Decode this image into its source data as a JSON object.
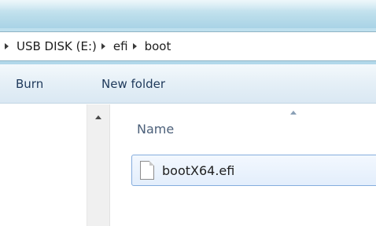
{
  "address_bar": {
    "crumbs": [
      "USB DISK (E:)",
      "efi",
      "boot"
    ]
  },
  "toolbar": {
    "burn_label": "Burn",
    "new_folder_label": "New folder"
  },
  "file_list": {
    "column_name": "Name",
    "files": [
      {
        "name": "bootX64.efi"
      }
    ]
  },
  "icons": {
    "file": "document-icon",
    "breadcrumb_separator": "chevron-right-icon",
    "scroll_up": "triangle-up-icon",
    "sort": "sort-ascending-icon"
  },
  "colors": {
    "glass": "#b9dcea",
    "toolbar_text": "#1e395b",
    "selection_border": "#84acdd",
    "header_text": "#4c607a"
  }
}
